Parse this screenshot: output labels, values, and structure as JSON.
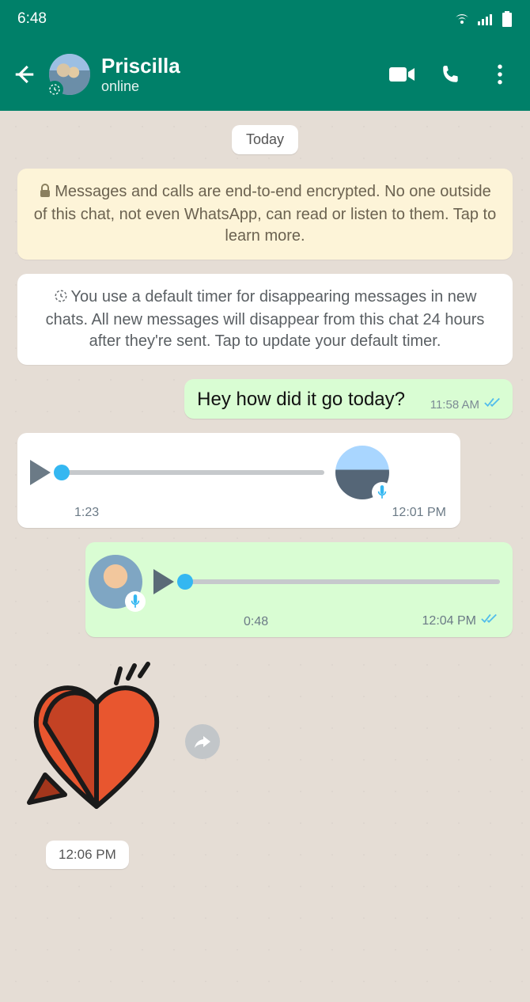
{
  "status": {
    "time": "6:48"
  },
  "header": {
    "contact_name": "Priscilla",
    "status": "online"
  },
  "chat": {
    "day_label": "Today",
    "encryption_notice": "Messages and calls are end-to-end encrypted. No one outside of this chat, not even WhatsApp, can read or listen to them. Tap to learn more.",
    "timer_notice": "You use a default timer for disappearing messages in new chats. All new messages will disappear from this chat 24 hours after they're sent. Tap to update your default timer.",
    "messages": [
      {
        "text": "Hey how did it go today?",
        "time": "11:58 AM"
      },
      {
        "duration": "1:23",
        "time": "12:01 PM"
      },
      {
        "duration": "0:48",
        "time": "12:04 PM"
      },
      {
        "time": "12:06 PM"
      }
    ]
  },
  "colors": {
    "teal": "#008069",
    "out": "#d9fdd3",
    "tick": "#53bdeb"
  }
}
